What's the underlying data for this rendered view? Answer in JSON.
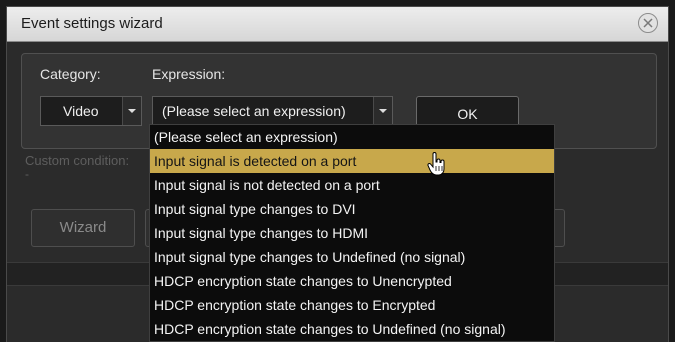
{
  "window": {
    "title": "Event settings wizard"
  },
  "category": {
    "label": "Category:",
    "value": "Video"
  },
  "expression": {
    "label": "Expression:",
    "value": "(Please select an expression)",
    "options": [
      "(Please select an expression)",
      "Input signal is detected on a port",
      "Input signal is not detected on a port",
      "Input signal type changes to DVI",
      "Input signal type changes to HDMI",
      "Input signal type changes to Undefined (no signal)",
      "HDCP encryption state changes to Unencrypted",
      "HDCP encryption state changes to Encrypted",
      "HDCP encryption state changes to Undefined (no signal)"
    ],
    "highlighted_index": 1,
    "highlight_color": "#c8a84b"
  },
  "ok_button": {
    "label": "OK"
  },
  "background": {
    "custom_condition_label": "Custom condition:",
    "custom_condition_value": "-",
    "wizard_button": "Wizard"
  }
}
